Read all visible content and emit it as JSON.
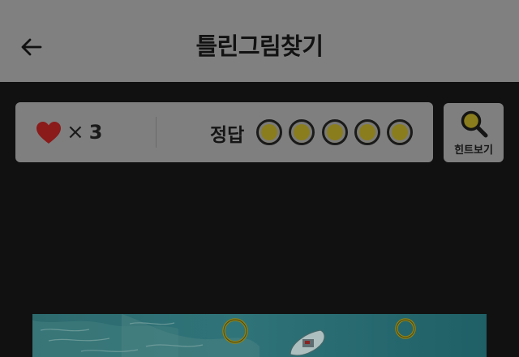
{
  "header": {
    "title": "틀린그림찾기",
    "back_icon": "arrow-left-icon"
  },
  "status": {
    "heart_icon": "heart-icon",
    "heart_color": "#8b1a1a",
    "lives_multiplier": "×",
    "lives_count": "3",
    "answer_label": "정답",
    "answers_found": 0,
    "answers_total": 5
  },
  "hint": {
    "label": "힌트보기",
    "icon": "magnifier-icon"
  },
  "colors": {
    "header_bg": "#808080",
    "panel_bg": "#7f7f7f",
    "answer_ring": "#8a7d1e",
    "page_bg": "#111111",
    "marker_ring": "#8f8416"
  },
  "game": {
    "markers": 2,
    "scene": "ocean-boat"
  }
}
